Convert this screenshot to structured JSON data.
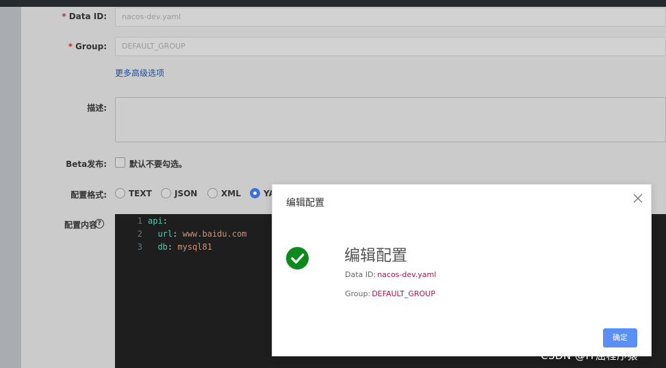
{
  "form": {
    "data_id": {
      "label": "Data ID:",
      "value": "nacos-dev.yaml"
    },
    "group": {
      "label": "Group:",
      "value": "DEFAULT_GROUP"
    },
    "advanced_link": "更多高级选项",
    "description": {
      "label": "描述:"
    },
    "beta": {
      "label": "Beta发布:",
      "checkbox_text": "默认不要勾选。"
    },
    "format": {
      "label": "配置格式:",
      "options": [
        "TEXT",
        "JSON",
        "XML",
        "YA"
      ],
      "selected": "YA"
    },
    "content": {
      "label": "配置内容",
      "help": "?"
    }
  },
  "editor": {
    "line_numbers": [
      "1",
      "2",
      "3"
    ],
    "lines": [
      {
        "key": "api",
        "sep": ":",
        "value": ""
      },
      {
        "indent": "  ",
        "key": "url",
        "sep": ": ",
        "value": "www.baidu.com"
      },
      {
        "indent": "  ",
        "key": "db",
        "sep": ": ",
        "value": "mysql81"
      }
    ]
  },
  "dialog": {
    "title": "编辑配置",
    "heading": "编辑配置",
    "data_id_label": "Data ID:",
    "data_id_value": "nacos-dev.yaml",
    "group_label": "Group:",
    "group_value": "DEFAULT_GROUP",
    "ok_label": "确定",
    "icons": {
      "close": "close-icon",
      "success": "check-circle-icon"
    },
    "colors": {
      "success": "#0c8a1e",
      "primary": "#5a8ff5",
      "value": "#b4124b"
    }
  },
  "watermark": "CSDN @IT屈程序猿"
}
